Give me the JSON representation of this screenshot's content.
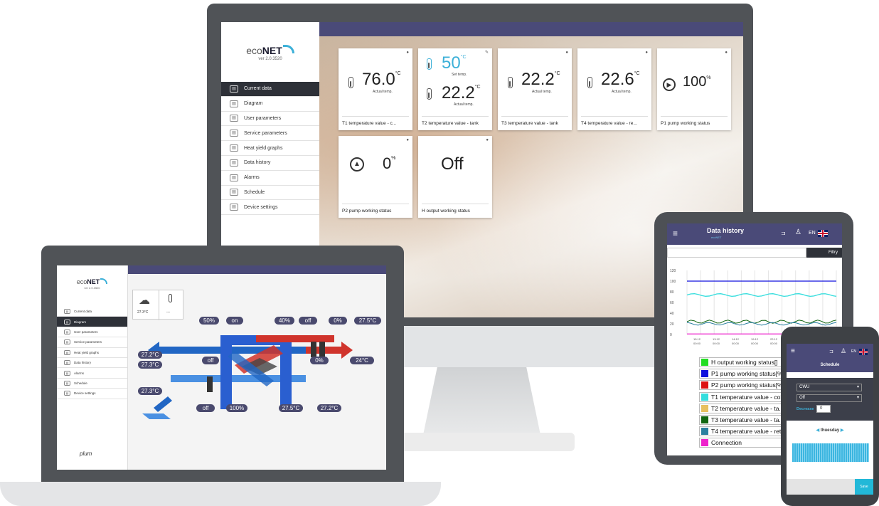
{
  "desktop": {
    "logo": {
      "brand_prefix": "eco",
      "brand_suffix": "NET",
      "version": "ver 2.0.3520"
    },
    "menu": [
      {
        "label": "Current data",
        "icon": "current-data-icon",
        "active": true
      },
      {
        "label": "Diagram",
        "icon": "diagram-icon",
        "active": false
      },
      {
        "label": "User parameters",
        "icon": "user-parameters-icon",
        "active": false
      },
      {
        "label": "Service parameters",
        "icon": "service-parameters-icon",
        "active": false
      },
      {
        "label": "Heat yield graphs",
        "icon": "heat-yield-icon",
        "active": false
      },
      {
        "label": "Data history",
        "icon": "data-history-icon",
        "active": false
      },
      {
        "label": "Alarms",
        "icon": "alarm-icon",
        "active": false
      },
      {
        "label": "Schedule",
        "icon": "schedule-icon",
        "active": false
      },
      {
        "label": "Device settings",
        "icon": "settings-icon",
        "active": false
      }
    ],
    "tiles": [
      {
        "value": "76.0",
        "unit": "°C",
        "sub": "Actual temp.",
        "name": "T1 temperature value - c..."
      },
      {
        "value": "50",
        "unit": "°C",
        "sub": "Set temp.",
        "value2": "22.2",
        "unit2": "°C",
        "sub2": "Actual temp.",
        "name": "T2 temperature value - tank"
      },
      {
        "value": "22.2",
        "unit": "°C",
        "sub": "Actual temp.",
        "name": "T3 temperature value - tank"
      },
      {
        "value": "22.6",
        "unit": "°C",
        "sub": "Actual temp.",
        "name": "T4 temperature value - re..."
      },
      {
        "value": "100",
        "unit": "%",
        "sub": "",
        "name": "P1 pump working status"
      },
      {
        "value": "0",
        "unit": "%",
        "sub": "",
        "name": "P2 pump working status"
      },
      {
        "value": "Off",
        "unit": "",
        "sub": "",
        "name": "H output working status"
      }
    ]
  },
  "laptop": {
    "logo": {
      "brand_prefix": "eco",
      "brand_suffix": "NET",
      "version": "ver 2.0.3520"
    },
    "menu": [
      {
        "label": "Current data",
        "active": false
      },
      {
        "label": "Diagram",
        "active": true
      },
      {
        "label": "User parameters",
        "active": false
      },
      {
        "label": "Service parameters",
        "active": false
      },
      {
        "label": "Heat yield graphs",
        "active": false
      },
      {
        "label": "Data history",
        "active": false
      },
      {
        "label": "Alarms",
        "active": false
      },
      {
        "label": "Schedule",
        "active": false
      },
      {
        "label": "Device settings",
        "active": false
      }
    ],
    "weather": {
      "outdoor": "27.3°C",
      "indoor": "---"
    },
    "diagram_labels": {
      "fan1": "50%",
      "bypass": "on",
      "fan2": "40%",
      "heater_state": "off",
      "pct": "0%",
      "t_top_right": "27.5°C",
      "t_left_top": "27.2°C",
      "t_left_mid": "27.3°C",
      "t_left_bottom": "27.3°C",
      "off_mid": "off",
      "damper": "0%",
      "t_right": "24°C",
      "off_bottom": "off",
      "fan_bottom": "100%",
      "t_bottom1": "27.5°C",
      "t_bottom2": "27.2°C"
    },
    "footer_logo": "plum"
  },
  "tablet": {
    "title": "Data history",
    "subtitle": "ecoNET",
    "lang": "EN",
    "filter_label": "Filtry",
    "y_ticks": [
      "120",
      "100",
      "80",
      "60",
      "40",
      "20",
      "0"
    ],
    "x_ticks": [
      "15:12 00:00",
      "13:12 00:00",
      "14:12 00:00",
      "19:12 00:00",
      "22:12 00:00",
      "23:12 00:00",
      "28:.. 00:.."
    ],
    "legend": [
      {
        "label": "H output working status[]",
        "color": "#22dd22"
      },
      {
        "label": "P1 pump working status[%",
        "color": "#1111dd"
      },
      {
        "label": "P2 pump working status[%",
        "color": "#dd1111"
      },
      {
        "label": "T1 temperature value - col",
        "color": "#33dddd"
      },
      {
        "label": "T2 temperature value - ta..",
        "color": "#e8c060"
      },
      {
        "label": "T3 temperature value - ta..",
        "color": "#116611"
      },
      {
        "label": "T4 temperature value - ret",
        "color": "#2a7fa0"
      },
      {
        "label": "Connection",
        "color": "#ee22cc"
      }
    ]
  },
  "phone": {
    "lang": "EN",
    "title": "Schedule",
    "select1": "CWU",
    "select2": "Off",
    "decrease_label": "Decrease",
    "decrease_value": "0",
    "day": "thuesday",
    "save": "Save"
  }
}
